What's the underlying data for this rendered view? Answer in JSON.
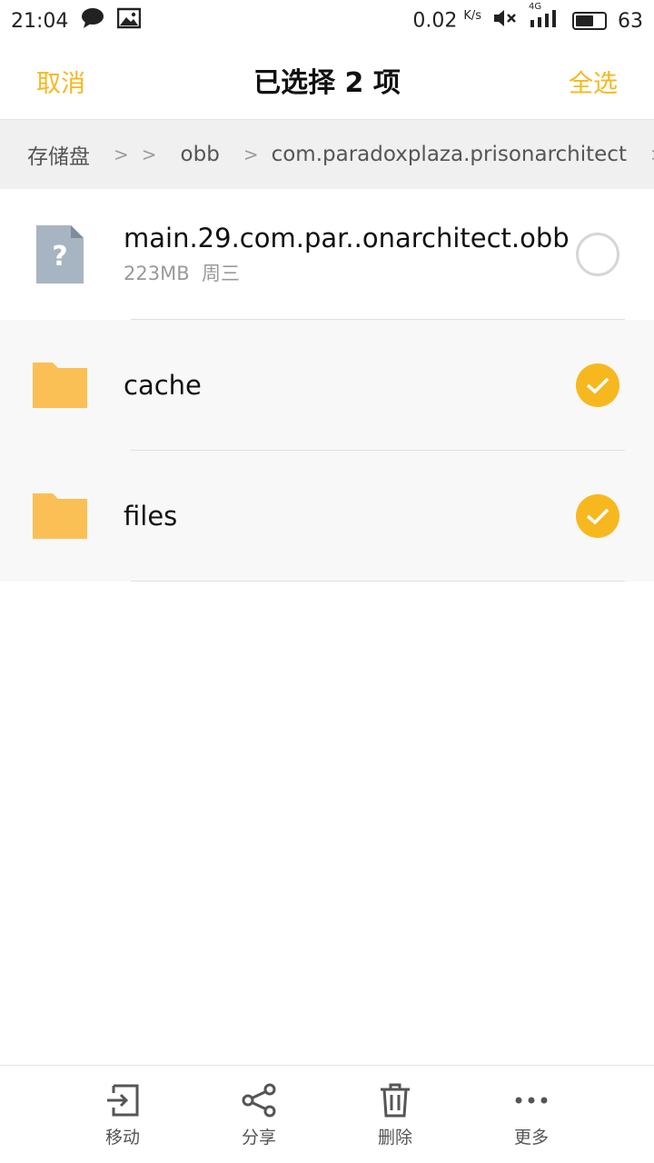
{
  "status_bar": {
    "time": "21:04",
    "net_speed": "0.02",
    "net_unit": "K/s",
    "network": "4G",
    "battery": "63",
    "battery_level": 0.63
  },
  "header": {
    "cancel_label": "取消",
    "title": "已选择 2 项",
    "select_all_label": "全选",
    "accent_color": "#f7b81f"
  },
  "breadcrumb": {
    "items": [
      "存储盘",
      "obb",
      "com.paradoxplaza.prisonarchitect"
    ]
  },
  "files": [
    {
      "name": "main.29.com.par..onarchitect.obb",
      "size": "223MB",
      "date": "周三",
      "type": "unknown-file",
      "selected": false
    },
    {
      "name": "cache",
      "type": "folder",
      "selected": true
    },
    {
      "name": "files",
      "type": "folder",
      "selected": true
    }
  ],
  "bottom_actions": [
    {
      "label": "移动",
      "icon": "move-icon"
    },
    {
      "label": "分享",
      "icon": "share-icon"
    },
    {
      "label": "删除",
      "icon": "delete-icon"
    },
    {
      "label": "更多",
      "icon": "more-icon"
    }
  ]
}
